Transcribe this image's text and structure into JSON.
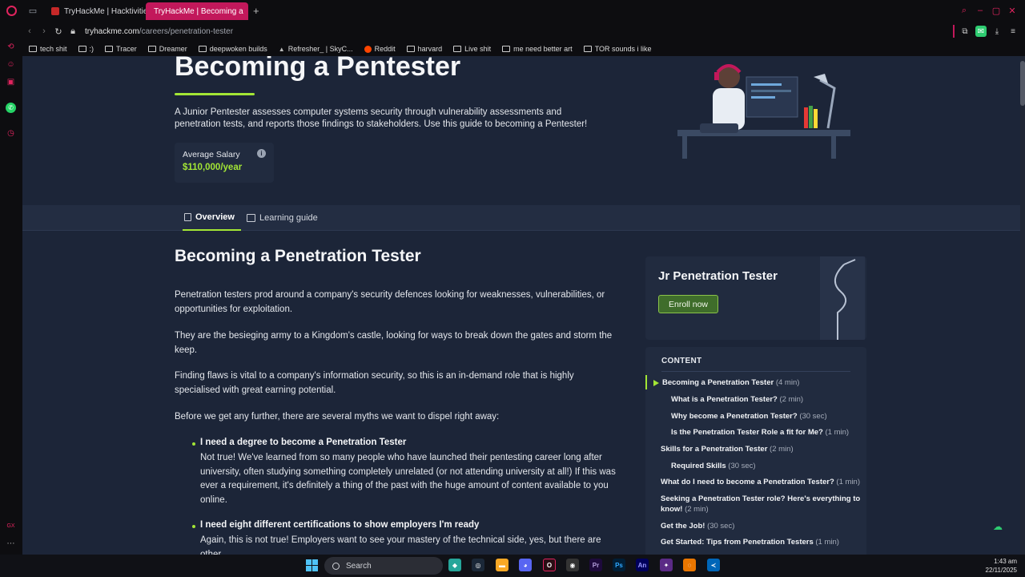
{
  "browser": {
    "tabs": [
      {
        "label": "TryHackMe | Hacktivities",
        "active": false
      },
      {
        "label": "TryHackMe | Becoming a",
        "active": true
      }
    ],
    "url_host": "tryhackme.com",
    "url_path": "/careers/penetration-tester",
    "bookmarks": [
      "tech shit",
      ":)",
      "Tracer",
      "Dreamer",
      "deepwoken builds",
      "Refresher_ | SkyC...",
      "Reddit",
      "harvard",
      "Live shit",
      "me need better art",
      "TOR sounds i like"
    ]
  },
  "hero": {
    "title": "Becoming a Pentester",
    "description": "A Junior Pentester assesses computer systems security through vulnerability assessments and penetration tests, and reports those findings to stakeholders. Use this guide to becoming a Pentester!",
    "salary_label": "Average Salary",
    "salary_value": "$110,000/year"
  },
  "page_tabs": {
    "overview": "Overview",
    "learning_guide": "Learning guide"
  },
  "article": {
    "title": "Becoming a Penetration Tester",
    "paragraphs": [
      "Penetration testers prod around a company's security defences looking for weaknesses, vulnerabilities, or opportunities for exploitation.",
      "They are the besieging army to a Kingdom's castle, looking for ways to break down the gates and storm the keep.",
      "Finding flaws is vital to a company's information security, so this is an in-demand role that is highly specialised with great earning potential.",
      "Before we get any further, there are several myths we want to dispel right away:"
    ],
    "myths": [
      {
        "head": "I need a degree to become a Penetration Tester",
        "body": "Not true! We've learned from so many people who have launched their pentesting career long after university, often studying something completely unrelated (or not attending university at all!) If this was ever a requirement, it's definitely a thing of the past with the huge amount of content available to you online."
      },
      {
        "head": "I need eight different certifications to show employers I'm ready",
        "body": "Again, this is not true! Employers want to see your mastery of the technical side, yes, but there are other"
      }
    ]
  },
  "enroll": {
    "title": "Jr Penetration Tester",
    "button": "Enroll now"
  },
  "content": {
    "heading": "CONTENT",
    "items": [
      {
        "label": "Becoming a Penetration Tester",
        "dur": "(4 min)"
      },
      {
        "label": "What is a Penetration Tester?",
        "dur": "(2 min)"
      },
      {
        "label": "Why become a Penetration Tester?",
        "dur": "(30 sec)"
      },
      {
        "label": "Is the Penetration Tester Role a fit for Me?",
        "dur": "(1 min)"
      },
      {
        "label": "Skills for a Penetration Tester",
        "dur": "(2 min)"
      },
      {
        "label": "Required Skills",
        "dur": "(30 sec)"
      },
      {
        "label": "What do I need to become a Penetration Tester?",
        "dur": "(1 min)"
      },
      {
        "label": "Seeking a Penetration Tester role? Here's everything to",
        "label2": "know!",
        "dur": "(2 min)"
      },
      {
        "label": "Get the Job!",
        "dur": "(30 sec)"
      },
      {
        "label": "Get Started: Tips from Penetration Testers",
        "dur": "(1 min)"
      }
    ]
  },
  "taskbar": {
    "search": "Search",
    "time": "1:43 am",
    "date": "22/11/2025",
    "apps": [
      "Pr",
      "Ps",
      "An"
    ]
  },
  "colors": {
    "accent": "#a3e635",
    "page_bg": "#1c2538",
    "tab_active": "#c2185b"
  }
}
